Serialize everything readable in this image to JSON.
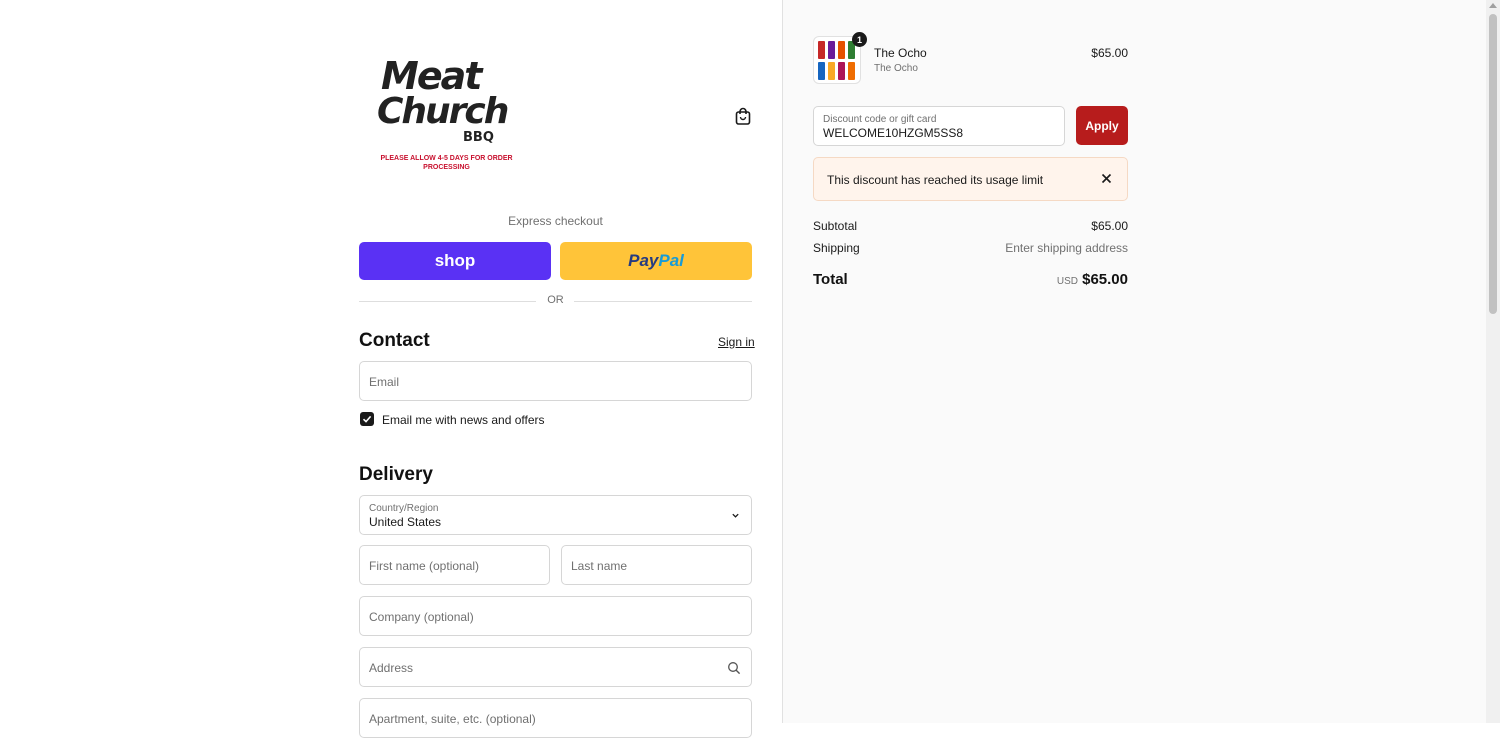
{
  "brand": {
    "logo_line1": "Meat",
    "logo_line2": "Church",
    "logo_line3": "BBQ",
    "logo_note": "PLEASE ALLOW 4-5 DAYS FOR ORDER PROCESSING"
  },
  "express": {
    "label": "Express checkout",
    "shop_label": "shop",
    "paypal_part1": "Pay",
    "paypal_part2": "Pal",
    "or_label": "OR"
  },
  "contact": {
    "heading": "Contact",
    "sign_in": "Sign in",
    "email_placeholder": "Email",
    "newsletter_label": "Email me with news and offers",
    "newsletter_checked": true
  },
  "delivery": {
    "heading": "Delivery",
    "country_label": "Country/Region",
    "country_value": "United States",
    "first_name_placeholder": "First name (optional)",
    "last_name_placeholder": "Last name",
    "company_placeholder": "Company (optional)",
    "address_placeholder": "Address",
    "apartment_placeholder": "Apartment, suite, etc. (optional)"
  },
  "order": {
    "item": {
      "name": "The Ocho",
      "variant": "The Ocho",
      "price": "$65.00",
      "quantity": "1"
    },
    "discount_label": "Discount code or gift card",
    "discount_value": "WELCOME10HZGM5SS8",
    "apply_label": "Apply",
    "alert_message": "This discount has reached its usage limit",
    "subtotal_label": "Subtotal",
    "subtotal_value": "$65.00",
    "shipping_label": "Shipping",
    "shipping_value": "Enter shipping address",
    "total_label": "Total",
    "total_currency": "USD",
    "total_value": "$65.00"
  },
  "colors": {
    "shop_pay": "#5a31f4",
    "paypal": "#ffc439",
    "apply": "#b71c1c",
    "alert_bg": "#fff4ec"
  }
}
